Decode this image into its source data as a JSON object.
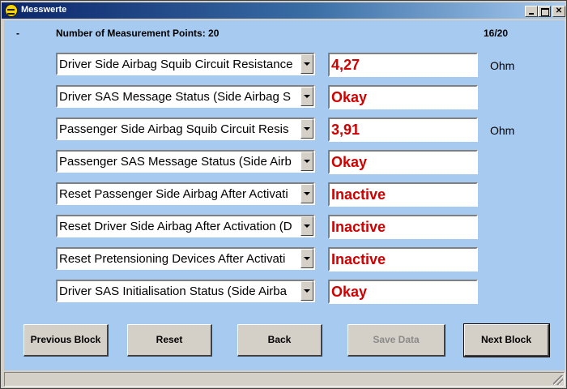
{
  "window": {
    "title": "Messwerte"
  },
  "header": {
    "dash": "-",
    "measurement_label": "Number of Measurement Points: 20",
    "page_counter": "16/20"
  },
  "rows": [
    {
      "label": "Driver Side Airbag Squib Circuit Resistance",
      "value": "4,27",
      "unit": "Ohm"
    },
    {
      "label": "Driver SAS Message Status (Side Airbag S",
      "value": "Okay",
      "unit": ""
    },
    {
      "label": "Passenger Side Airbag Squib Circuit Resis",
      "value": "3,91",
      "unit": "Ohm"
    },
    {
      "label": "Passenger SAS Message Status (Side Airb",
      "value": "Okay",
      "unit": ""
    },
    {
      "label": "Reset Passenger Side Airbag After Activati",
      "value": "Inactive",
      "unit": ""
    },
    {
      "label": "Reset Driver Side Airbag After Activation (D",
      "value": "Inactive",
      "unit": ""
    },
    {
      "label": "Reset Pretensioning Devices After Activati",
      "value": "Inactive",
      "unit": ""
    },
    {
      "label": "Driver SAS Initialisation Status (Side Airba",
      "value": "Okay",
      "unit": ""
    }
  ],
  "buttons": {
    "previous_block": "Previous Block",
    "reset": "Reset",
    "back": "Back",
    "save_data": "Save Data",
    "next_block": "Next Block"
  },
  "colors": {
    "client_bg": "#a6caf0",
    "value_text": "#d00000",
    "titlebar_start": "#0a246a"
  },
  "icons": {
    "app": "opel-logo-icon",
    "minimize": "minimize-icon",
    "maximize": "maximize-icon",
    "close": "close-icon",
    "dropdown": "chevron-down-icon"
  }
}
